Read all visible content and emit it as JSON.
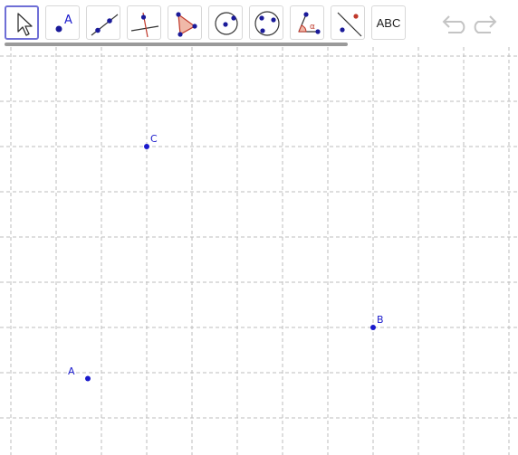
{
  "toolbar": {
    "tools": [
      {
        "id": "move",
        "icon": "arrow-cursor-icon",
        "active": true
      },
      {
        "id": "point",
        "icon": "point-icon",
        "label": "A"
      },
      {
        "id": "line",
        "icon": "line-through-points-icon"
      },
      {
        "id": "perpendicular",
        "icon": "perpendicular-line-icon"
      },
      {
        "id": "polygon",
        "icon": "polygon-icon"
      },
      {
        "id": "circle",
        "icon": "circle-center-point-icon"
      },
      {
        "id": "circle-three-points",
        "icon": "circle-three-points-icon"
      },
      {
        "id": "angle",
        "icon": "angle-icon",
        "label": "α"
      },
      {
        "id": "reflect",
        "icon": "reflect-about-line-icon"
      },
      {
        "id": "text",
        "icon": "text-icon",
        "label": "ABC"
      }
    ],
    "undo": "undo-icon",
    "redo": "redo-icon"
  },
  "canvas": {
    "points": [
      {
        "name": "C",
        "x": 3,
        "y": 6
      },
      {
        "name": "B",
        "x": 8,
        "y": 2
      },
      {
        "name": "A",
        "x": 1.7,
        "y": 0.87
      }
    ]
  },
  "colors": {
    "point": "#1a1acc",
    "grid": "#bdbdbd",
    "active_border": "#6f6fd6",
    "scrollbar": "#9a9a9a"
  }
}
